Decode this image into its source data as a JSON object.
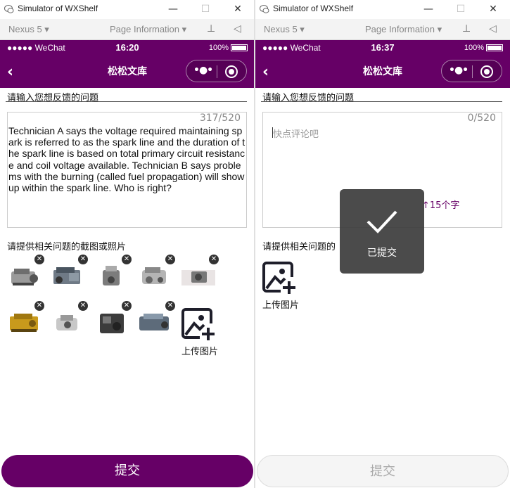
{
  "window": {
    "title": "Simulator of WXShelf"
  },
  "devbar": {
    "device": "Nexus 5 ▾",
    "page_info": "Page Information ▾"
  },
  "colors": {
    "brand": "#660066",
    "toast_bg": "#3c3c3c"
  },
  "screens": [
    {
      "status": {
        "carrier": "●●●●● WeChat",
        "time": "16:20",
        "battery": "100%"
      },
      "nav": {
        "title": "松松文库"
      },
      "question_label": "请输入您想反馈的问题",
      "counter": "317/520",
      "content": "Technician A says the voltage required maintaining spark is referred to as the spark line and the duration of the spark line is based on total primary circuit resistance and coil voltage available. Technician B says problems with the burning (called fuel propagation) will show up within the spark line. Who is right?",
      "photo_label": "请提供相关问题的截图或照片",
      "upload_label": "上传图片",
      "submit_label": "提交",
      "thumbnails": [
        {
          "icon": "engine-photo"
        },
        {
          "icon": "engine-photo"
        },
        {
          "icon": "engine-photo"
        },
        {
          "icon": "engine-photo"
        },
        {
          "icon": "engine-photo"
        },
        {
          "icon": "engine-photo"
        },
        {
          "icon": "engine-photo"
        },
        {
          "icon": "engine-photo"
        },
        {
          "icon": "engine-photo"
        }
      ]
    },
    {
      "status": {
        "carrier": "●●●●● WeChat",
        "time": "16:37",
        "battery": "100%"
      },
      "nav": {
        "title": "松松文库"
      },
      "question_label": "请输入您想反馈的问题",
      "counter": "0/520",
      "placeholder": "快点评论吧",
      "min_hint": "↑15个字",
      "photo_label": "请提供相关问题的",
      "upload_label": "上传图片",
      "submit_label": "提交",
      "toast": {
        "text": "已提交",
        "icon": "check-icon"
      }
    }
  ]
}
